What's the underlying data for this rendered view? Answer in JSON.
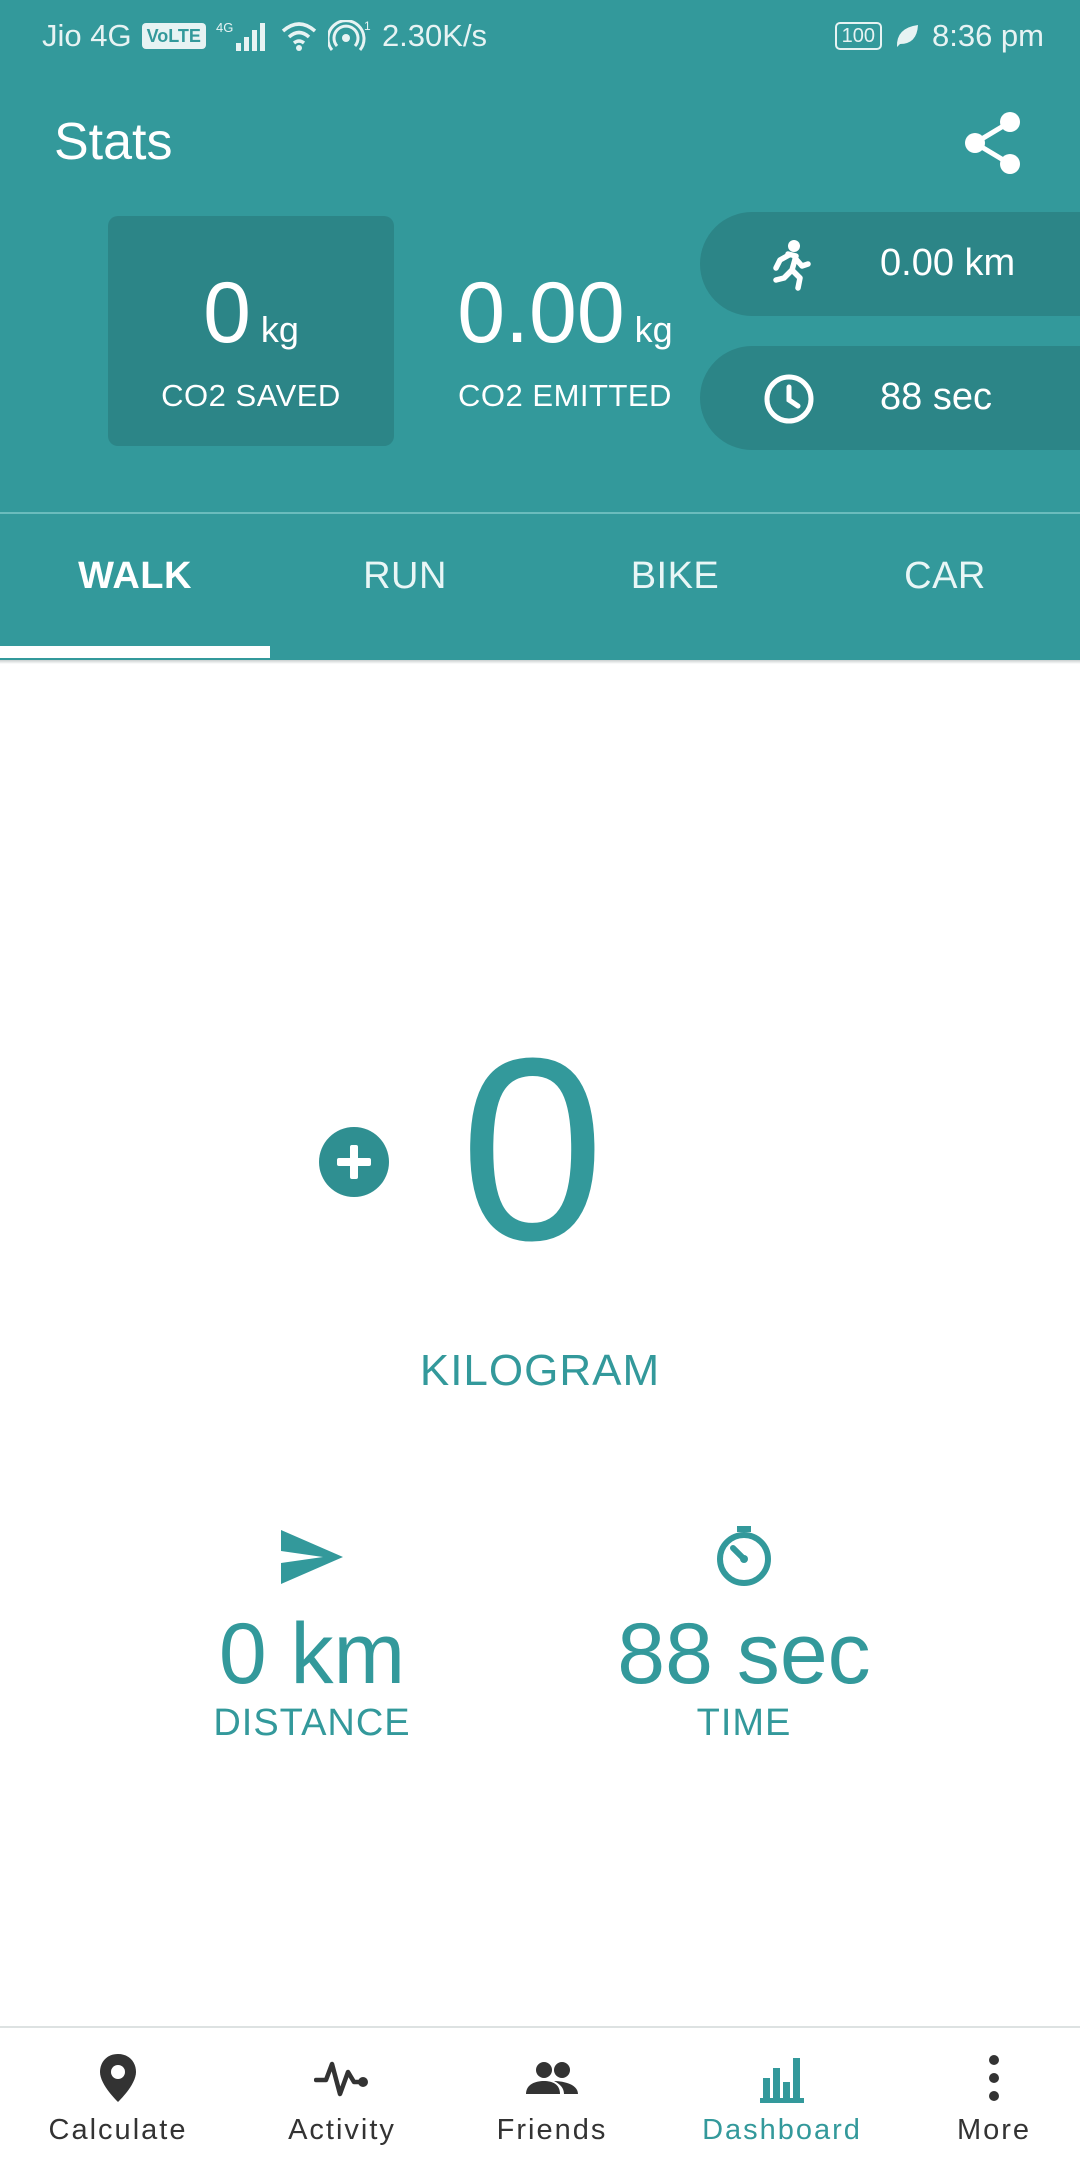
{
  "status_bar": {
    "carrier": "Jio 4G",
    "volte": "VoLTE",
    "net": "4G",
    "speed": "2.30K/s",
    "battery": "100",
    "time": "8:36 pm"
  },
  "header": {
    "title": "Stats"
  },
  "summary": {
    "saved": {
      "value": "0",
      "unit": "kg",
      "label": "CO2 SAVED"
    },
    "emitted": {
      "value": "0.00",
      "unit": "kg",
      "label": "CO2 EMITTED"
    },
    "distance_pill": "0.00 km",
    "time_pill": "88 sec"
  },
  "tabs": [
    {
      "label": "WALK",
      "active": true
    },
    {
      "label": "RUN"
    },
    {
      "label": "BIKE"
    },
    {
      "label": "CAR"
    }
  ],
  "main": {
    "value": "0",
    "unit": "KILOGRAM",
    "distance": {
      "value": "0 km",
      "label": "DISTANCE"
    },
    "time": {
      "value": "88 sec",
      "label": "TIME"
    }
  },
  "bottom_nav": [
    {
      "label": "Calculate",
      "icon": "location-pin-icon"
    },
    {
      "label": "Activity",
      "icon": "pulse-icon"
    },
    {
      "label": "Friends",
      "icon": "people-icon"
    },
    {
      "label": "Dashboard",
      "icon": "bar-chart-icon",
      "active": true
    },
    {
      "label": "More",
      "icon": "more-vertical-icon"
    }
  ],
  "colors": {
    "primary": "#33999b",
    "primary_dark": "#2c8587"
  }
}
